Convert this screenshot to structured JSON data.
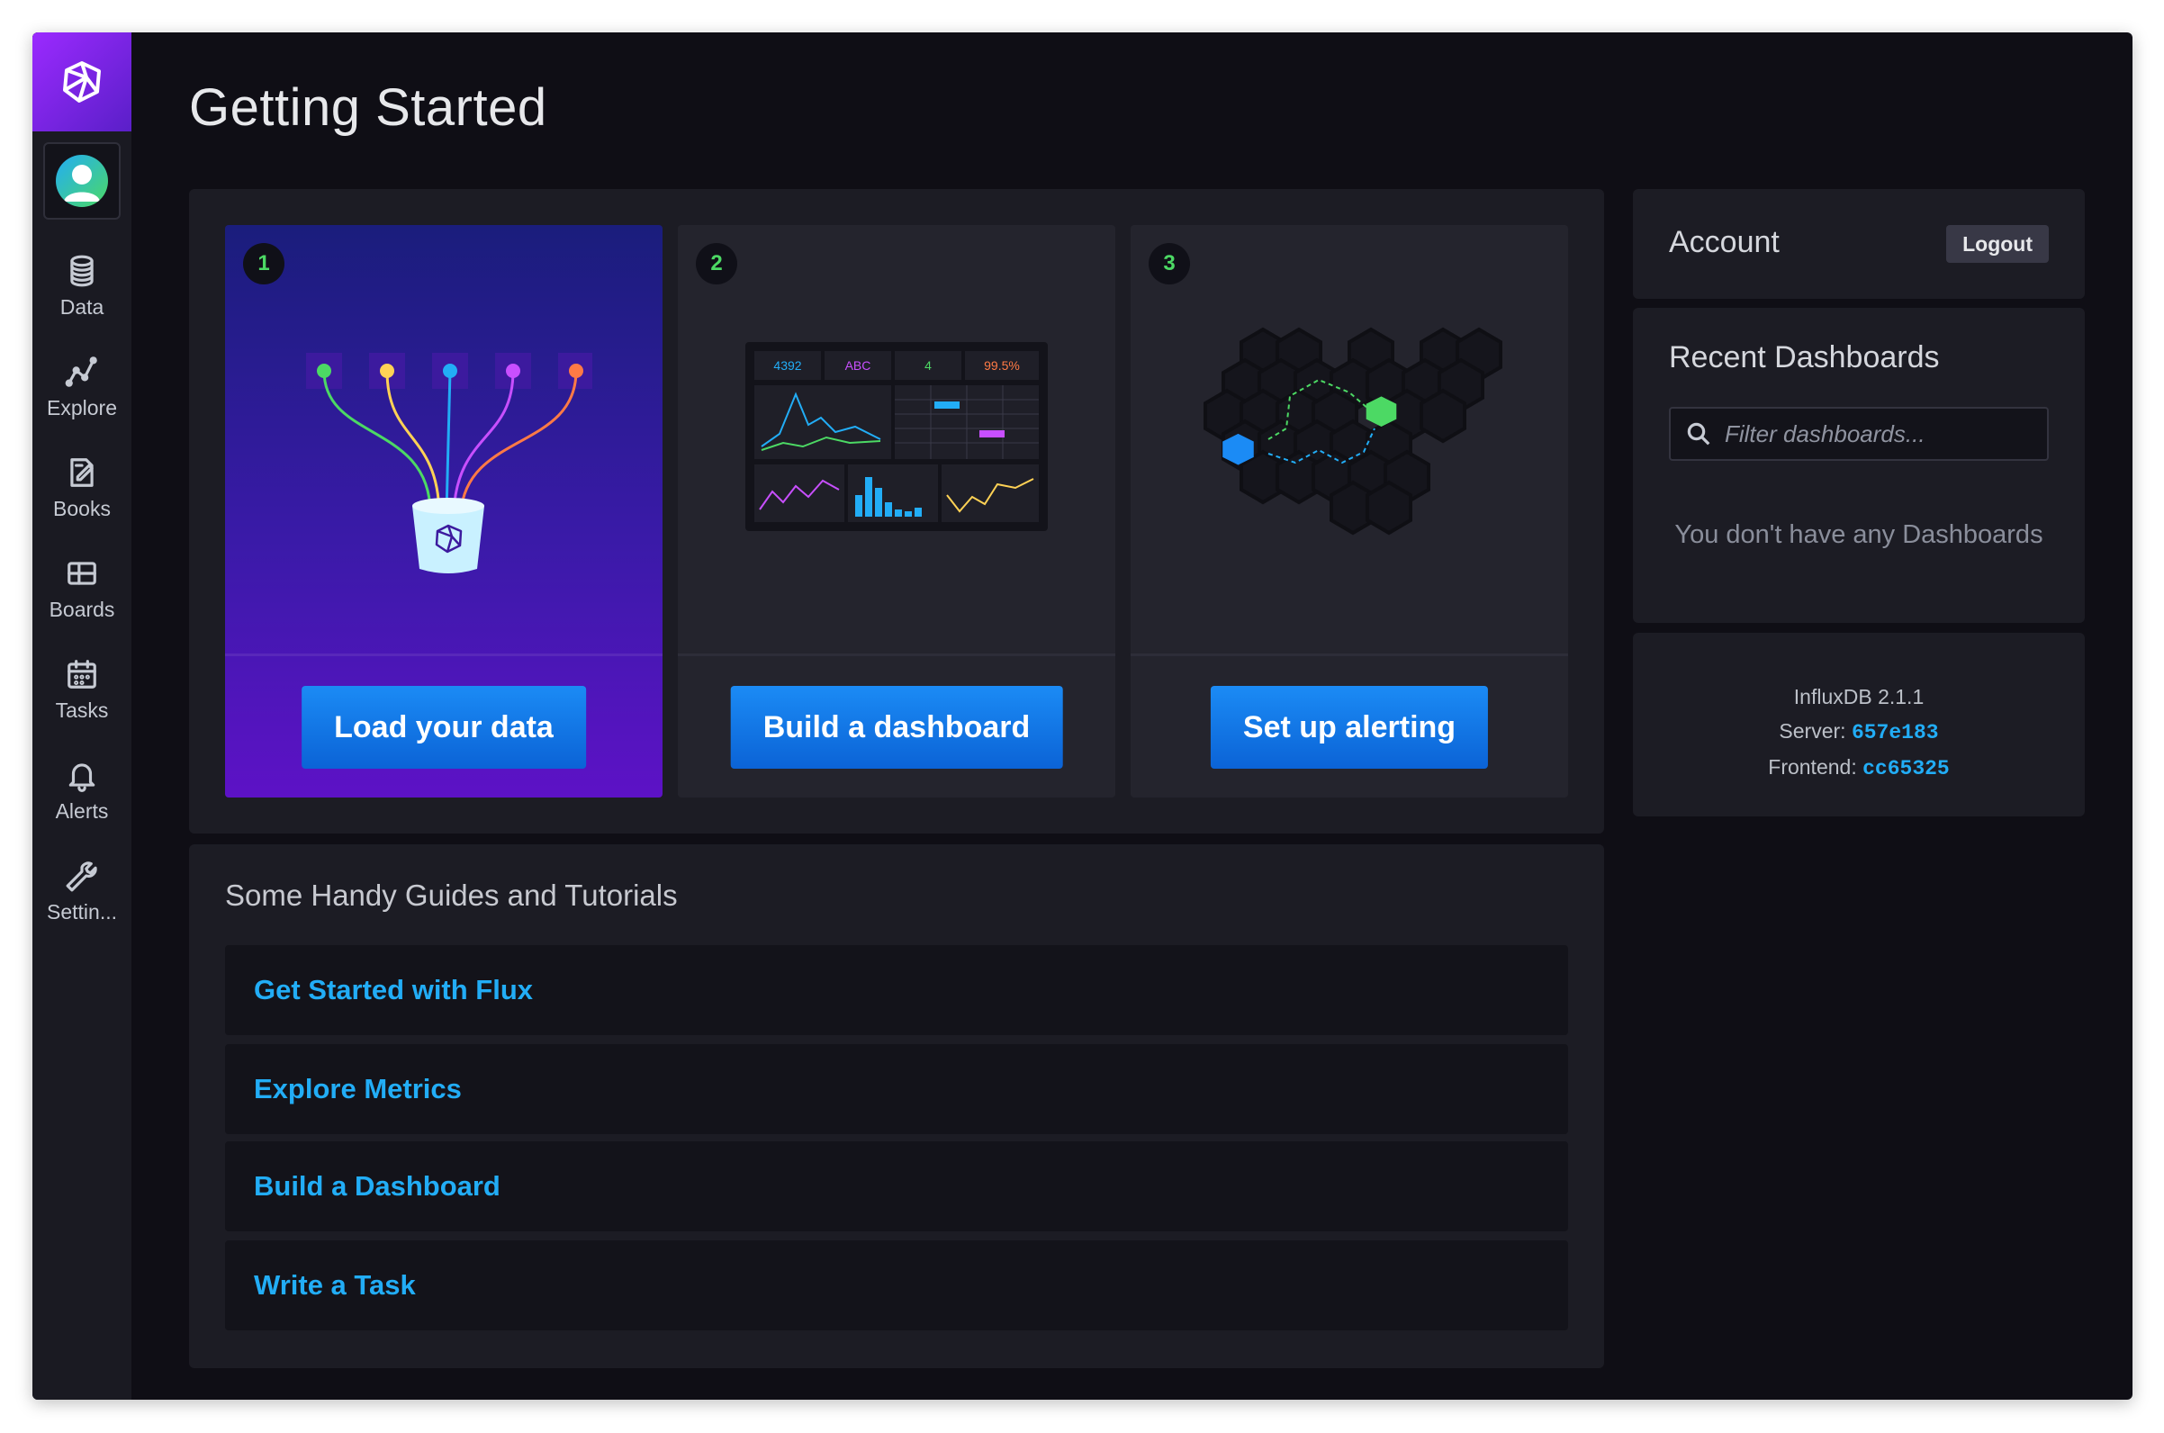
{
  "sidebar": {
    "items": [
      {
        "label": "Data",
        "icon": "database-icon"
      },
      {
        "label": "Explore",
        "icon": "graph-icon"
      },
      {
        "label": "Books",
        "icon": "notebook-icon"
      },
      {
        "label": "Boards",
        "icon": "dashboard-grid-icon"
      },
      {
        "label": "Tasks",
        "icon": "calendar-icon"
      },
      {
        "label": "Alerts",
        "icon": "bell-icon"
      },
      {
        "label": "Settin...",
        "icon": "wrench-icon"
      }
    ]
  },
  "page": {
    "title": "Getting Started"
  },
  "cards": [
    {
      "step": "1",
      "button_label": "Load your data"
    },
    {
      "step": "2",
      "button_label": "Build a dashboard",
      "widget_values": [
        "4392",
        "ABC",
        "4",
        "99.5%"
      ]
    },
    {
      "step": "3",
      "button_label": "Set up alerting"
    }
  ],
  "guides": {
    "title": "Some Handy Guides and Tutorials",
    "links": [
      "Get Started with Flux",
      "Explore Metrics",
      "Build a Dashboard",
      "Write a Task"
    ]
  },
  "account": {
    "title": "Account",
    "logout_label": "Logout"
  },
  "recent_dashboards": {
    "title": "Recent Dashboards",
    "filter_placeholder": "Filter dashboards...",
    "empty_message": "You don't have any Dashboards"
  },
  "version": {
    "product": "InfluxDB 2.1.1",
    "server_label": "Server:",
    "server_value": "657e183",
    "frontend_label": "Frontend:",
    "frontend_value": "cc65325"
  },
  "colors": {
    "accent_blue": "#22adf6",
    "accent_green": "#4cd964",
    "button_blue": "#0b63d6",
    "logo_purple": "#9b2aff",
    "background": "#0f0e15"
  }
}
